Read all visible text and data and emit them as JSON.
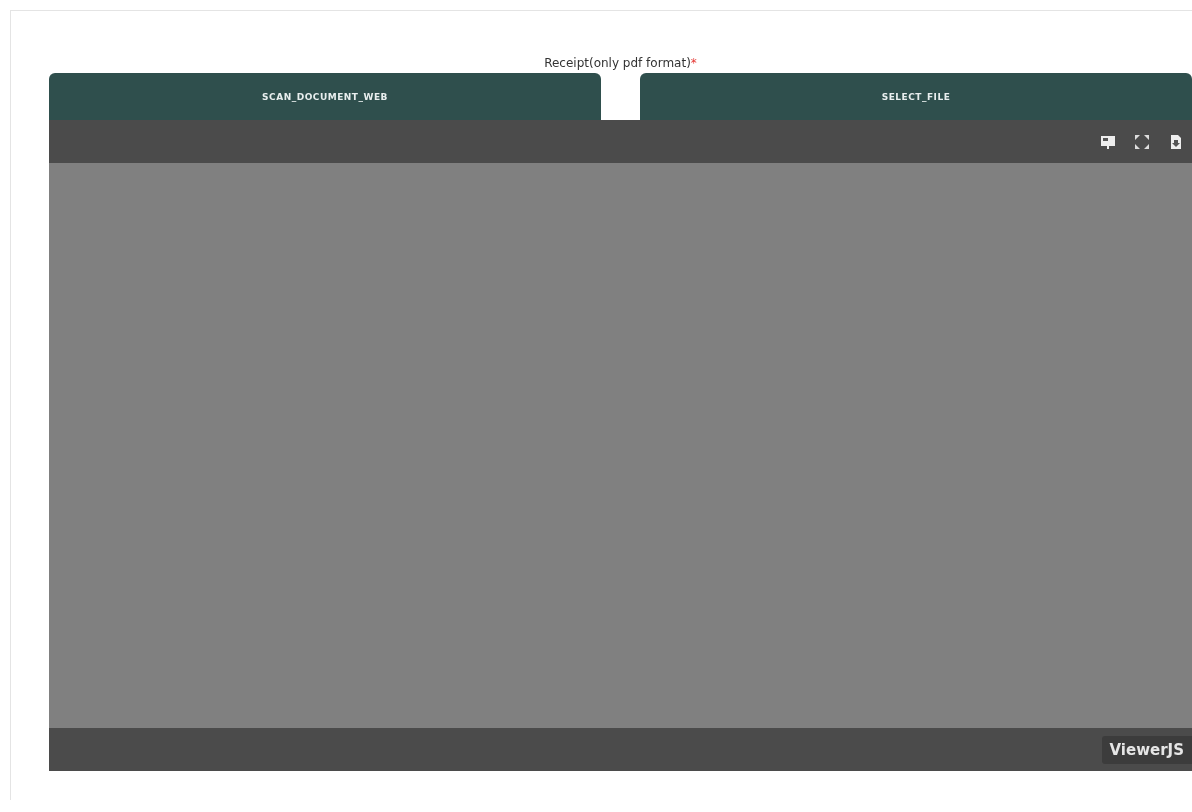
{
  "field": {
    "label": "Receipt(only pdf format)",
    "required_mark": "*"
  },
  "buttons": [
    {
      "label": "SCAN_DOCUMENT_WEB"
    },
    {
      "label": "SELECT_FILE"
    }
  ],
  "viewer": {
    "badge": "ViewerJS"
  }
}
